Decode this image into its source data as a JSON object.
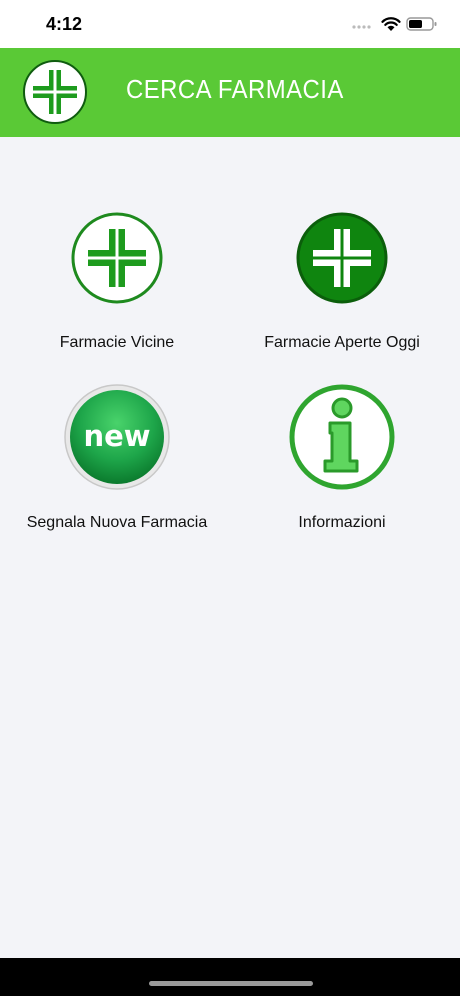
{
  "status_bar": {
    "time": "4:12"
  },
  "header": {
    "title": "CERCA FARMACIA",
    "logo_icon": "pharmacy-cross-icon"
  },
  "menu": {
    "items": [
      {
        "label": "Farmacie Vicine",
        "icon": "pharmacy-cross-outline-icon"
      },
      {
        "label": "Farmacie Aperte Oggi",
        "icon": "pharmacy-cross-filled-icon"
      },
      {
        "label": "Segnala Nuova Farmacia",
        "icon": "new-badge-icon",
        "badge_text": "new"
      },
      {
        "label": "Informazioni",
        "icon": "info-icon"
      }
    ]
  },
  "colors": {
    "header_bg": "#5ac936",
    "icon_green": "#1e9b1e",
    "dark_green": "#0f7d0f",
    "background": "#f3f4f8"
  }
}
